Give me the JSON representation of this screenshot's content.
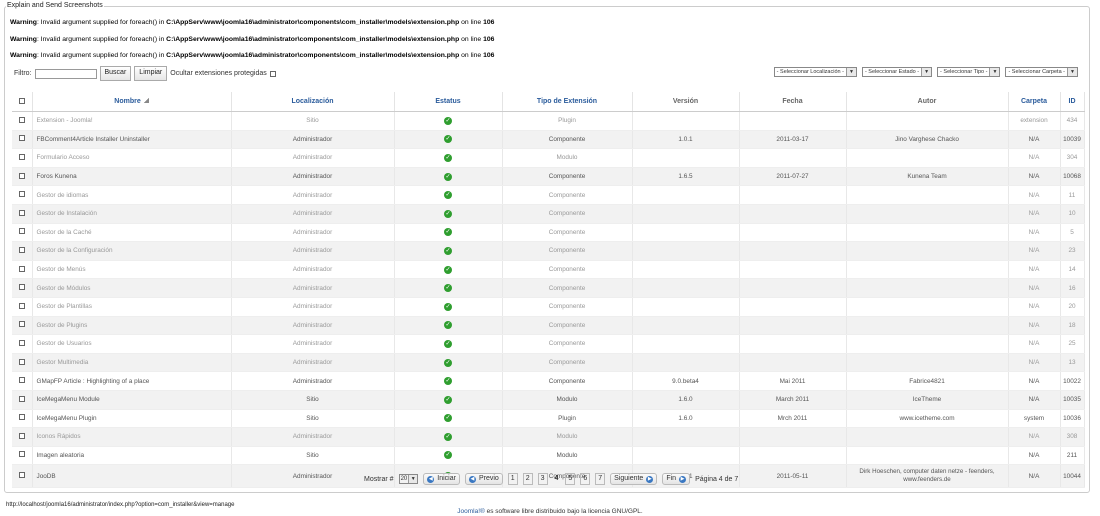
{
  "legend": "Explain and Send Screenshots",
  "warnings": [
    {
      "label": "Warning",
      "msg": ": Invalid argument supplied for foreach() in ",
      "path": "C:\\AppServ\\www\\joomla16\\administrator\\components\\com_installer\\models\\extension.php",
      "online": " on line ",
      "line": "106"
    },
    {
      "label": "Warning",
      "msg": ": Invalid argument supplied for foreach() in ",
      "path": "C:\\AppServ\\www\\joomla16\\administrator\\components\\com_installer\\models\\extension.php",
      "online": " on line ",
      "line": "106"
    },
    {
      "label": "Warning",
      "msg": ": Invalid argument supplied for foreach() in ",
      "path": "C:\\AppServ\\www\\joomla16\\administrator\\components\\com_installer\\models\\extension.php",
      "online": " on line ",
      "line": "106"
    }
  ],
  "filter": {
    "label": "Filtro:",
    "value": "",
    "search": "Buscar",
    "clear": "Limpiar",
    "protected": "Ocultar extensiones protegidas"
  },
  "selects": [
    "- Seleccionar Localización -",
    "- Seleccionar Estado -",
    "- Seleccionar Tipo -",
    "- Seleccionar Carpeta -"
  ],
  "columns": {
    "nombre": "Nombre",
    "localizacion": "Localización",
    "estatus": "Estatus",
    "tipo": "Tipo de Extensión",
    "version": "Versión",
    "fecha": "Fecha",
    "autor": "Autor",
    "carpeta": "Carpeta",
    "id": "ID"
  },
  "rows": [
    {
      "name": "Extension - Joomla!",
      "loc": "Sitio",
      "type": "Plugin",
      "version": "",
      "date": "",
      "author": "",
      "folder": "extension",
      "id": "434"
    },
    {
      "name": "FBComment4Article Installer Uninstaller",
      "loc": "Administrador",
      "type": "Componente",
      "version": "1.0.1",
      "date": "2011-03-17",
      "author": "Jino Varghese Chacko",
      "folder": "N/A",
      "id": "10039"
    },
    {
      "name": "Formulario Acceso",
      "loc": "Administrador",
      "type": "Modulo",
      "version": "",
      "date": "",
      "author": "",
      "folder": "N/A",
      "id": "304"
    },
    {
      "name": "Foros Kunena",
      "loc": "Administrador",
      "type": "Componente",
      "version": "1.6.5",
      "date": "2011-07-27",
      "author": "Kunena Team",
      "folder": "N/A",
      "id": "10068"
    },
    {
      "name": "Gestor de idiomas",
      "loc": "Administrador",
      "type": "Componente",
      "version": "",
      "date": "",
      "author": "",
      "folder": "N/A",
      "id": "11"
    },
    {
      "name": "Gestor de Instalación",
      "loc": "Administrador",
      "type": "Componente",
      "version": "",
      "date": "",
      "author": "",
      "folder": "N/A",
      "id": "10"
    },
    {
      "name": "Gestor de la Caché",
      "loc": "Administrador",
      "type": "Componente",
      "version": "",
      "date": "",
      "author": "",
      "folder": "N/A",
      "id": "5"
    },
    {
      "name": "Gestor de la Configuración",
      "loc": "Administrador",
      "type": "Componente",
      "version": "",
      "date": "",
      "author": "",
      "folder": "N/A",
      "id": "23"
    },
    {
      "name": "Gestor de Menús",
      "loc": "Administrador",
      "type": "Componente",
      "version": "",
      "date": "",
      "author": "",
      "folder": "N/A",
      "id": "14"
    },
    {
      "name": "Gestor de Módulos",
      "loc": "Administrador",
      "type": "Componente",
      "version": "",
      "date": "",
      "author": "",
      "folder": "N/A",
      "id": "16"
    },
    {
      "name": "Gestor de Plantillas",
      "loc": "Administrador",
      "type": "Componente",
      "version": "",
      "date": "",
      "author": "",
      "folder": "N/A",
      "id": "20"
    },
    {
      "name": "Gestor de Plugins",
      "loc": "Administrador",
      "type": "Componente",
      "version": "",
      "date": "",
      "author": "",
      "folder": "N/A",
      "id": "18"
    },
    {
      "name": "Gestor de Usuarios",
      "loc": "Administrador",
      "type": "Componente",
      "version": "",
      "date": "",
      "author": "",
      "folder": "N/A",
      "id": "25"
    },
    {
      "name": "Gestor Multimedia",
      "loc": "Administrador",
      "type": "Componente",
      "version": "",
      "date": "",
      "author": "",
      "folder": "N/A",
      "id": "13"
    },
    {
      "name": "GMapFP Article : Highlighting of a place",
      "loc": "Administrador",
      "type": "Componente",
      "version": "9.0.beta4",
      "date": "Mai 2011",
      "author": "Fabrice4821",
      "folder": "N/A",
      "id": "10022"
    },
    {
      "name": "IceMegaMenu Module",
      "loc": "Sitio",
      "type": "Modulo",
      "version": "1.6.0",
      "date": "March 2011",
      "author": "IceTheme",
      "folder": "N/A",
      "id": "10035"
    },
    {
      "name": "IceMegaMenu Plugin",
      "loc": "Sitio",
      "type": "Plugin",
      "version": "1.6.0",
      "date": "Mrch 2011",
      "author": "www.icetheme.com",
      "folder": "system",
      "id": "10036"
    },
    {
      "name": "Iconos Rápidos",
      "loc": "Administrador",
      "type": "Modulo",
      "version": "",
      "date": "",
      "author": "",
      "folder": "N/A",
      "id": "308"
    },
    {
      "name": "Imagen aleatoria",
      "loc": "Sitio",
      "type": "Modulo",
      "version": "",
      "date": "",
      "author": "",
      "folder": "N/A",
      "id": "211"
    },
    {
      "name": "JooDB",
      "loc": "Administrador",
      "type": "Componente",
      "version": "1.6.1",
      "date": "2011-05-11",
      "author": "Dirk Hoeschen, computer daten netze - feenders, www.feenders.de",
      "folder": "N/A",
      "id": "10044"
    }
  ],
  "pager": {
    "show": "Mostrar #",
    "limit": "20",
    "start": "Iniciar",
    "prev": "Previo",
    "pages": [
      "1",
      "2",
      "3",
      "4",
      "5",
      "6",
      "7"
    ],
    "current": "4",
    "next": "Siguiente",
    "end": "Fin",
    "info": "Página 4 de 7"
  },
  "status_url": "http://localhost/joomla16/administrator/index.php?option=com_installer&view=manage",
  "footer": {
    "link": "Joomla!®",
    "text": " es software libre distribuido bajo la licencia GNU/GPL."
  },
  "dimmed_rows": [
    0,
    2,
    4,
    5,
    6,
    7,
    8,
    9,
    10,
    11,
    12,
    13,
    17
  ]
}
